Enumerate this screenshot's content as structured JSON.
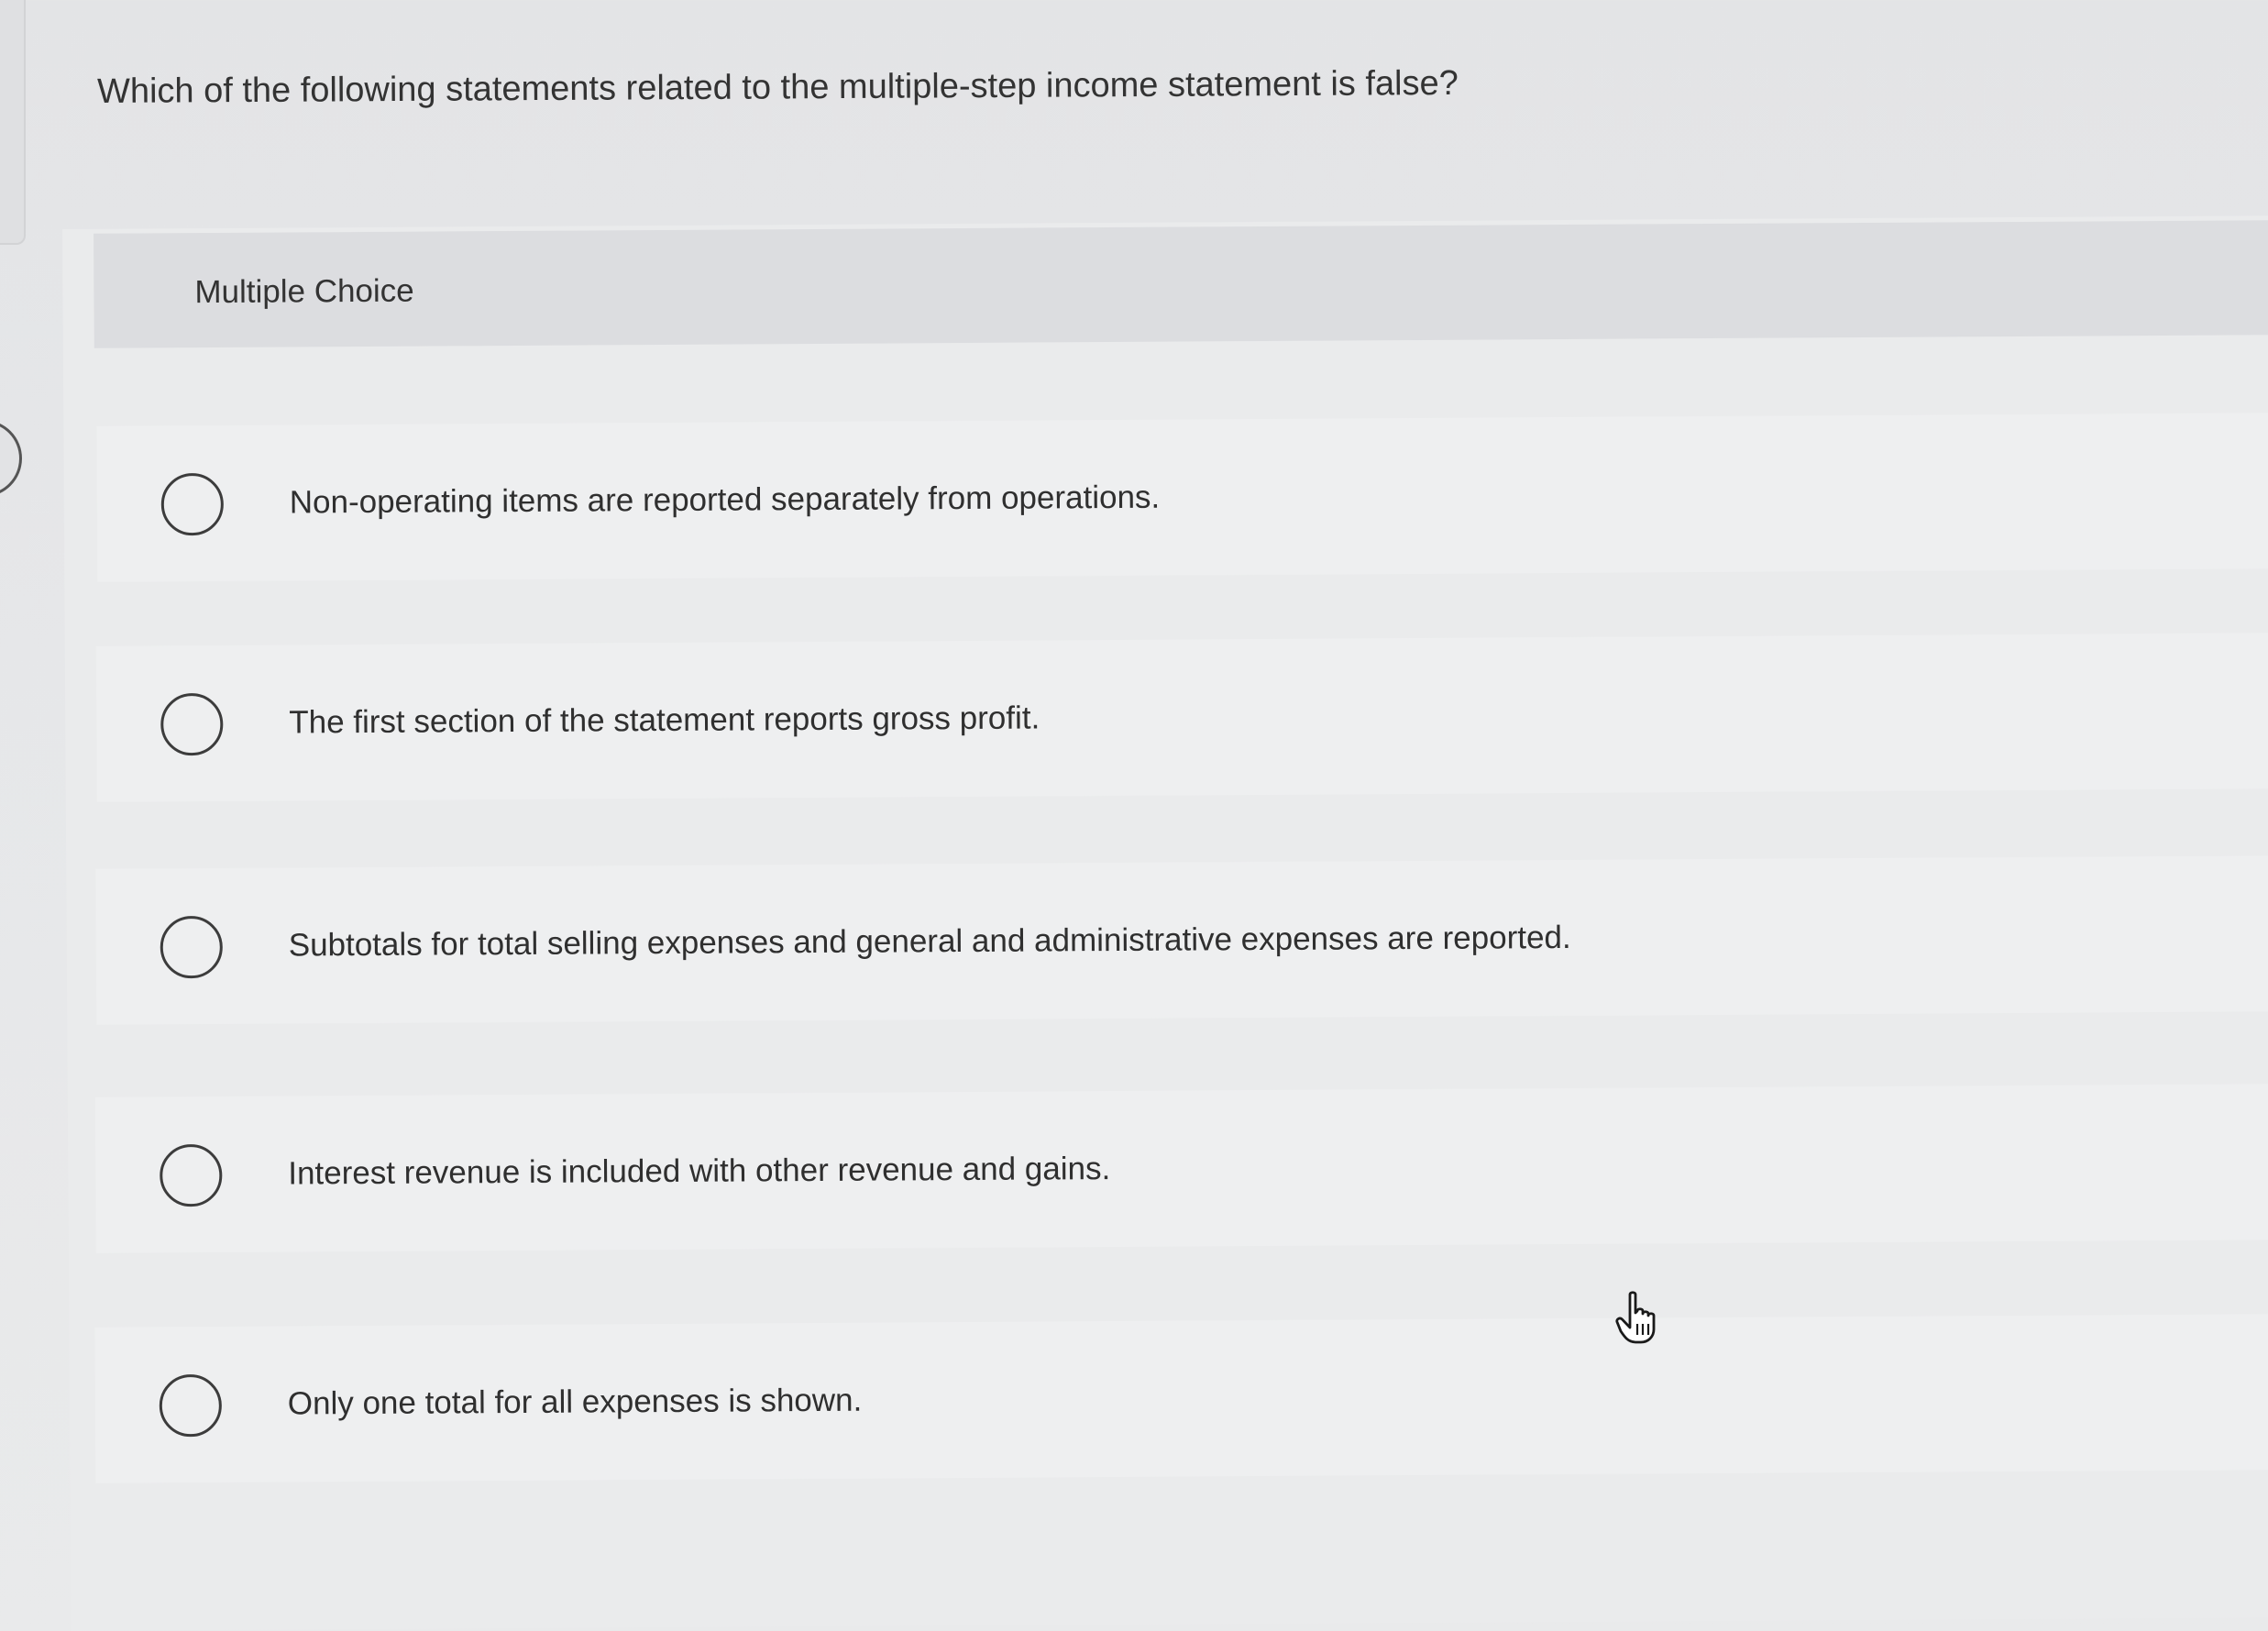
{
  "question": {
    "text": "Which of the following statements related to the multiple-step income statement is false?"
  },
  "multiple_choice": {
    "label": "Multiple Choice",
    "options": [
      {
        "text": "Non-operating items are reported separately from operations.",
        "selected": false
      },
      {
        "text": "The first section of the statement reports gross profit.",
        "selected": false
      },
      {
        "text": "Subtotals for total selling expenses and general and administrative expenses are reported.",
        "selected": false
      },
      {
        "text": "Interest revenue is included with other revenue and gains.",
        "selected": false
      },
      {
        "text": "Only one total for all expenses is shown.",
        "selected": false
      }
    ]
  },
  "icons": {
    "pointer": "hand-pointer-icon"
  }
}
